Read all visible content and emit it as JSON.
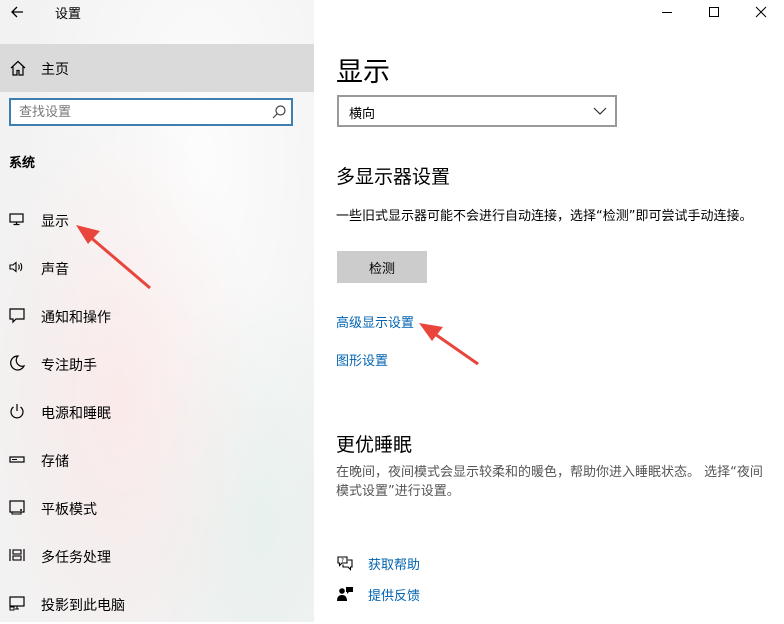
{
  "window": {
    "title": "设置"
  },
  "sidebar": {
    "home_label": "主页",
    "search": {
      "placeholder": "查找设置",
      "value": ""
    },
    "section_label": "系统",
    "items": [
      {
        "label": "显示",
        "icon": "monitor-icon"
      },
      {
        "label": "声音",
        "icon": "speaker-icon"
      },
      {
        "label": "通知和操作",
        "icon": "notification-icon"
      },
      {
        "label": "专注助手",
        "icon": "moon-icon"
      },
      {
        "label": "电源和睡眠",
        "icon": "power-icon"
      },
      {
        "label": "存储",
        "icon": "storage-icon"
      },
      {
        "label": "平板模式",
        "icon": "tablet-icon"
      },
      {
        "label": "多任务处理",
        "icon": "multitask-icon"
      },
      {
        "label": "投影到此电脑",
        "icon": "project-icon"
      }
    ]
  },
  "main": {
    "title": "显示",
    "orientation": {
      "value": "横向"
    },
    "multi_display": {
      "heading": "多显示器设置",
      "description": "一些旧式显示器可能不会进行自动连接，选择“检测”即可尝试手动连接。",
      "detect_button": "检测",
      "advanced_link": "高级显示设置",
      "graphics_link": "图形设置"
    },
    "sleep": {
      "heading": "更优睡眠",
      "description": "在晚间，夜间模式会显示较柔和的暖色，帮助你进入睡眠状态。 选择“夜间模式设置”进行设置。"
    },
    "help": {
      "get_help": "获取帮助",
      "feedback": "提供反馈"
    }
  },
  "colors": {
    "accent": "#0063b1",
    "sidebar_bg": "#f2f2f2",
    "arrow": "#e8453c"
  }
}
